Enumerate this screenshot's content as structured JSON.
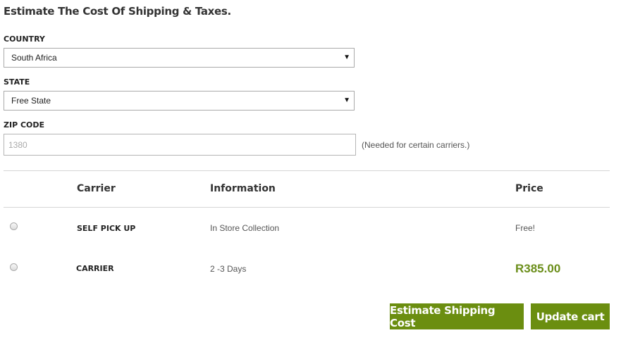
{
  "title": "Estimate The Cost Of Shipping & Taxes.",
  "country": {
    "label": "COUNTRY",
    "value": "South Africa"
  },
  "state": {
    "label": "STATE",
    "value": "Free State"
  },
  "zip": {
    "label": "ZIP CODE",
    "value": "1380",
    "hint": "(Needed for certain carriers.)"
  },
  "table": {
    "headers": {
      "carrier": "Carrier",
      "information": "Information",
      "price": "Price"
    },
    "rows": [
      {
        "carrier": "SELF PICK UP",
        "information": "In Store Collection",
        "price": "Free!"
      },
      {
        "carrier": "CARRIER",
        "information": "2 -3 Days",
        "price": "R385.00"
      }
    ]
  },
  "buttons": {
    "estimate": "Estimate Shipping Cost",
    "update": "Update cart"
  },
  "colors": {
    "accent": "#6b8e10",
    "price": "#6b8e1a"
  },
  "icons": {
    "dropdown": "chevron-down-icon"
  }
}
